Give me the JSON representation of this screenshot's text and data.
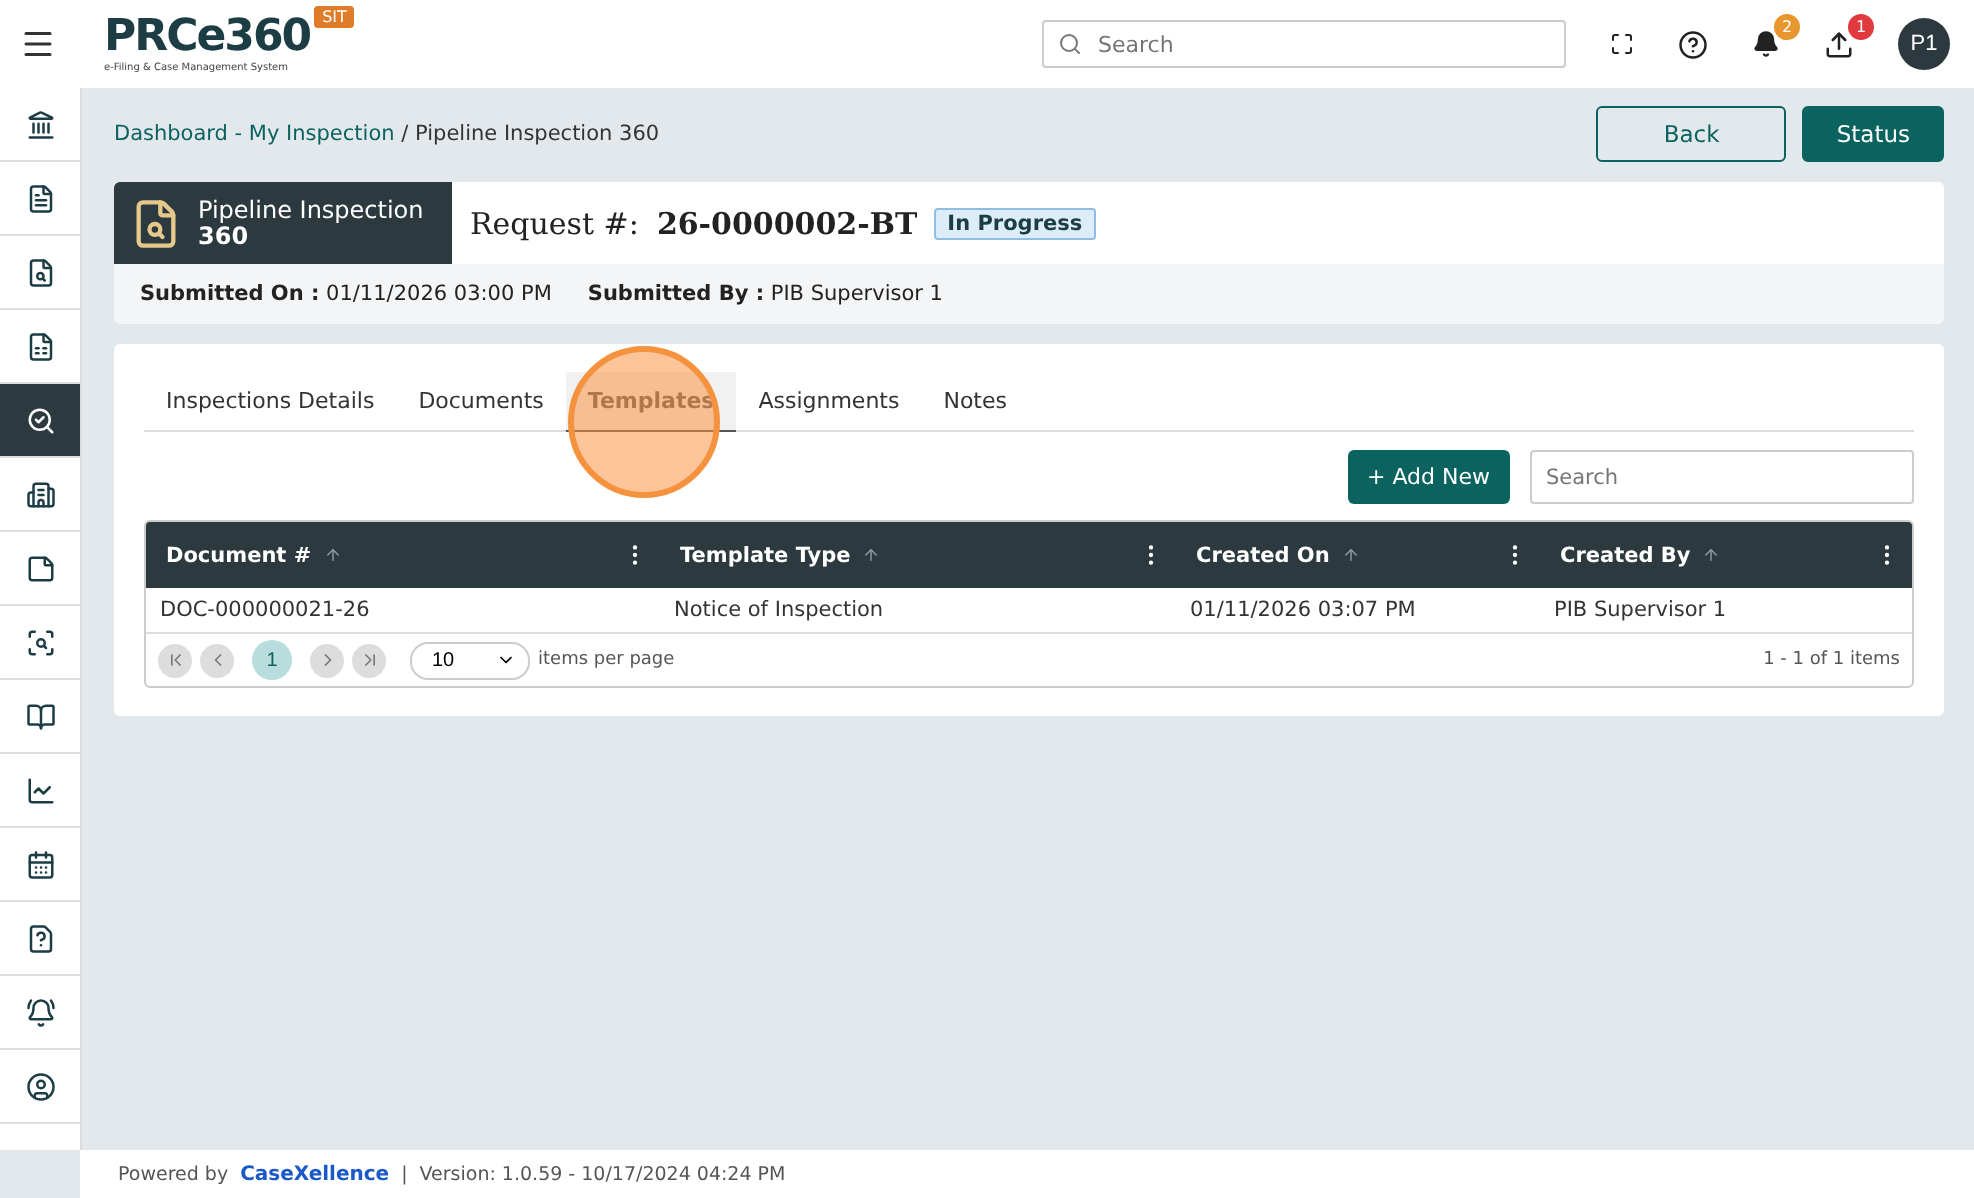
{
  "header": {
    "logo": {
      "wordmark": "PRCe360",
      "tagline": "e-Filing & Case Management System",
      "env_badge": "SIT"
    },
    "search": {
      "placeholder": "Search"
    },
    "notifications": {
      "count": "2"
    },
    "uploads": {
      "count": "1"
    },
    "avatar": "P1"
  },
  "sidebar": {
    "items": [
      {
        "selected": false
      },
      {
        "selected": false
      },
      {
        "selected": false
      },
      {
        "selected": false
      },
      {
        "selected": true
      },
      {
        "selected": false
      },
      {
        "selected": false
      },
      {
        "selected": false
      },
      {
        "selected": false
      },
      {
        "selected": false
      },
      {
        "selected": false
      },
      {
        "selected": false
      },
      {
        "selected": false
      },
      {
        "selected": false
      }
    ]
  },
  "breadcrumb": {
    "links": [
      "Dashboard - My Inspection"
    ],
    "separator": "/",
    "current": "Pipeline Inspection 360"
  },
  "actions": [
    "Back",
    "Status"
  ],
  "summary": {
    "module_title": "Pipeline Inspection",
    "module_subtitle": "360",
    "request_label": "Request #:",
    "request_number": "26-0000002-BT",
    "status": "In Progress",
    "submitted_on_label": "Submitted On :",
    "submitted_on": "01/11/2026 03:00 PM",
    "submitted_by_label": "Submitted By :",
    "submitted_by": "PIB Supervisor 1"
  },
  "tabs": [
    {
      "label": "Inspections Details",
      "selected": false
    },
    {
      "label": "Documents",
      "selected": false
    },
    {
      "label": "Templates",
      "selected": true
    },
    {
      "label": "Assignments",
      "selected": false
    },
    {
      "label": "Notes",
      "selected": false
    }
  ],
  "click_marker": {
    "visible": true
  },
  "grid": {
    "add_button": "+ Add New",
    "search": {
      "placeholder": "Search"
    },
    "columns": [
      "Document #",
      "Template Type",
      "Created On",
      "Created By"
    ],
    "rows": [
      [
        "DOC-000000021-26",
        "Notice of Inspection",
        "01/11/2026 03:07 PM",
        "PIB Supervisor 1"
      ]
    ],
    "pager": {
      "pages": [
        {
          "label": "1",
          "selected": true
        }
      ],
      "page_size": "10",
      "page_size_label": "items per page",
      "summary": "1 - 1 of 1 items"
    }
  },
  "footer": {
    "powered_by": "Powered by",
    "brand": "CaseXellence",
    "separator": "|",
    "version": "Version: 1.0.59 - 10/17/2024 04:24 PM"
  }
}
